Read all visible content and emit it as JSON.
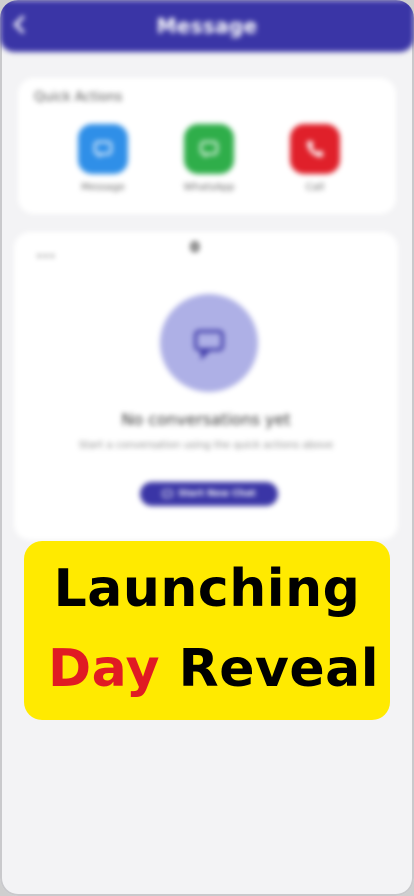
{
  "appbar": {
    "title": "Message"
  },
  "quick_actions": {
    "title": "Quick Actions",
    "items": [
      {
        "label": "Message",
        "icon": "message-icon",
        "color": "#2f8fe8"
      },
      {
        "label": "WhatsApp",
        "icon": "whatsapp-icon",
        "color": "#2fae4a"
      },
      {
        "label": "Call",
        "icon": "phone-icon",
        "color": "#e0202a"
      }
    ]
  },
  "conversations": {
    "small_label": "•••",
    "count": "0",
    "empty_title": "No conversations yet",
    "empty_subtitle": "Start a conversation using the quick actions above",
    "start_button": "Start New Chat"
  },
  "promo": {
    "line1": "Launching",
    "word_red": "Day",
    "word_black": "Reveal",
    "colors": {
      "background": "#ffea00",
      "red": "#e01b23",
      "text": "#000000"
    }
  },
  "colors": {
    "accent": "#3a35a6",
    "empty_circle": "#aeb0e6"
  }
}
